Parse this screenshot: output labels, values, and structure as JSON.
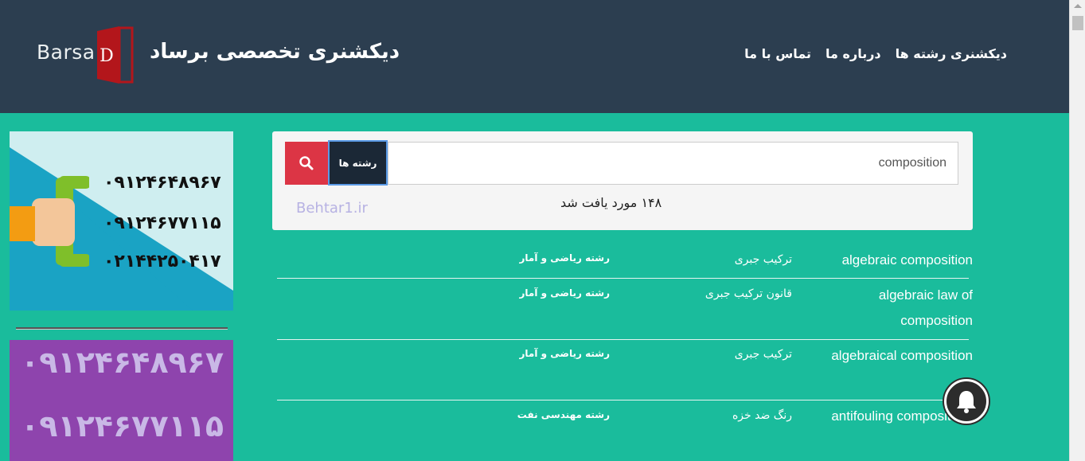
{
  "header": {
    "logo_text": "Barsa",
    "logo_letter": "D",
    "site_title": "دیکشنری تخصصی برساد",
    "nav": [
      {
        "label": "دیکشنری رشته ها"
      },
      {
        "label": "درباره ما"
      },
      {
        "label": "تماس با ما"
      }
    ]
  },
  "ads": {
    "ad1_numbers": [
      "۰۹۱۲۴۶۴۸۹۶۷",
      "۰۹۱۲۴۶۷۷۱۱۵",
      "۰۲۱۴۴۲۵۰۴۱۷"
    ],
    "ad2_numbers": [
      "۰۹۱۲۴۶۴۸۹۶۷",
      "۰۹۱۲۴۶۷۷۱۱۵"
    ]
  },
  "search": {
    "query": "composition",
    "category_label": "رشته ها",
    "results_count": "۱۴۸ مورد یافت شد",
    "watermark": "Behtar1.ir"
  },
  "results": [
    {
      "en": "algebraic composition",
      "fa": "ترکیب جبری",
      "field": "رشته ریاضی و آمار"
    },
    {
      "en": "algebraic law of composition",
      "fa": "قانون ترکیب جبری",
      "field": "رشته ریاضی و آمار"
    },
    {
      "en": "algebraical composition",
      "fa": "ترکیب جبری",
      "field": "رشته ریاضی و آمار"
    },
    {
      "en": "antifouling composition;",
      "fa": "رنگ ضد خزه",
      "field": "رشته مهندسی نفت"
    }
  ],
  "colors": {
    "background": "#1abc9c",
    "header": "#2c3e50",
    "search_button": "#dc3545",
    "category_button": "#1b2836",
    "ad2_background": "#8e44ad"
  },
  "icons": {
    "search": "search-icon",
    "bell": "bell-icon"
  }
}
